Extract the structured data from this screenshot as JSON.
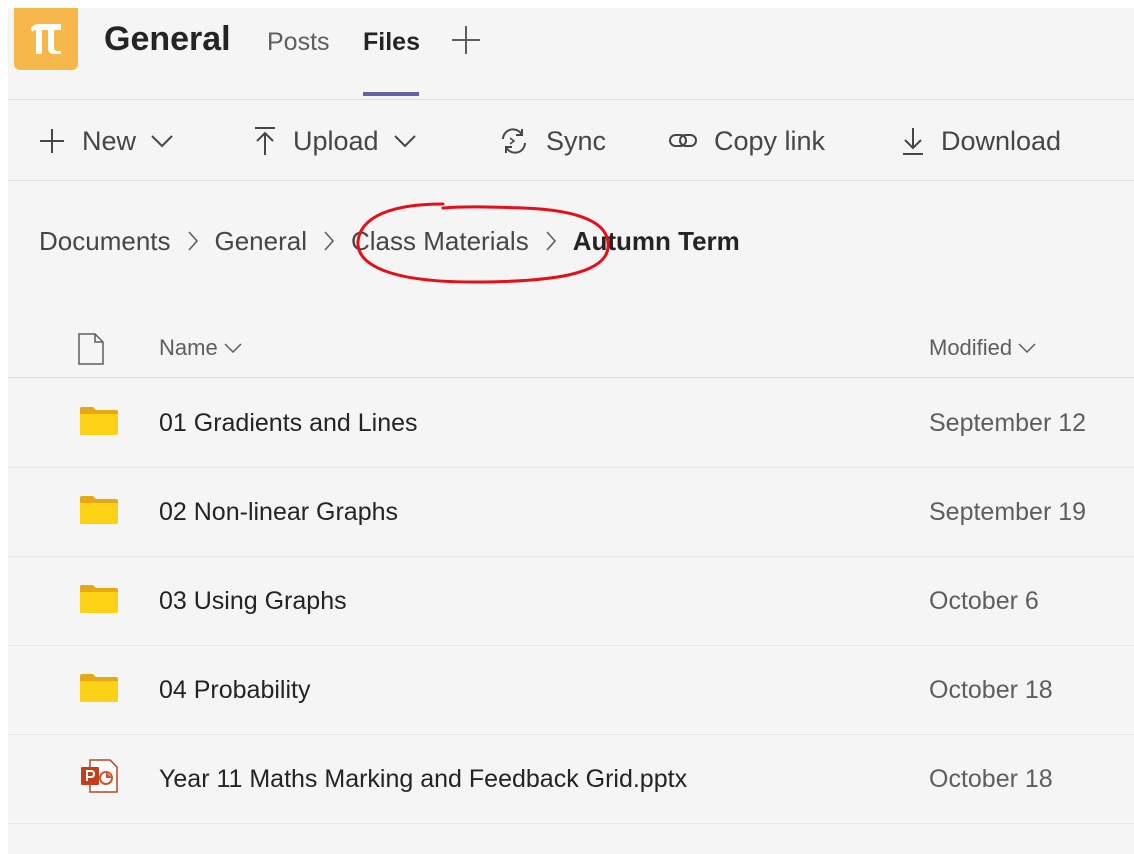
{
  "header": {
    "channel_name": "General",
    "tabs": [
      {
        "label": "Posts",
        "active": false
      },
      {
        "label": "Files",
        "active": true
      }
    ],
    "avatar_icon": "pi-icon",
    "avatar_color": "#f7b84b",
    "accent_color": "#6264a7"
  },
  "toolbar": {
    "new_label": "New",
    "upload_label": "Upload",
    "sync_label": "Sync",
    "copy_link_label": "Copy link",
    "download_label": "Download"
  },
  "breadcrumb": {
    "items": [
      "Documents",
      "General",
      "Class Materials"
    ],
    "current": "Autumn Term",
    "annotation_color": "#e3101a"
  },
  "table": {
    "columns": {
      "name": "Name",
      "modified": "Modified"
    },
    "rows": [
      {
        "type": "folder",
        "name": "01 Gradients and Lines",
        "modified": "September 12"
      },
      {
        "type": "folder",
        "name": "02 Non-linear Graphs",
        "modified": "September 19"
      },
      {
        "type": "folder",
        "name": "03 Using Graphs",
        "modified": "October 6"
      },
      {
        "type": "folder",
        "name": "04 Probability",
        "modified": "October 18"
      },
      {
        "type": "pptx",
        "name": "Year 11 Maths Marking and Feedback Grid.pptx",
        "modified": "October 18"
      }
    ]
  }
}
